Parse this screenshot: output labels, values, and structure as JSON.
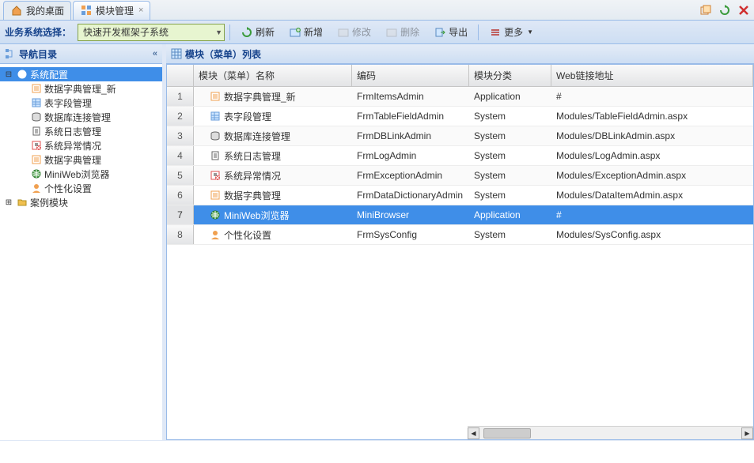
{
  "tabs": [
    {
      "label": "我的桌面",
      "icon": "home"
    },
    {
      "label": "模块管理",
      "icon": "module",
      "closable": true
    }
  ],
  "toolbar": {
    "label": "业务系统选择：",
    "combo_value": "快速开发框架子系统",
    "refresh": "刷新",
    "add": "新增",
    "edit": "修改",
    "delete": "删除",
    "export": "导出",
    "more": "更多"
  },
  "side": {
    "title": "导航目录",
    "tree": [
      {
        "label": "系统配置",
        "icon": "gear",
        "expanded": true,
        "selected": true,
        "children": [
          {
            "label": "数据字典管理_新",
            "icon": "list"
          },
          {
            "label": "表字段管理",
            "icon": "grid"
          },
          {
            "label": "数据库连接管理",
            "icon": "db"
          },
          {
            "label": "系统日志管理",
            "icon": "log"
          },
          {
            "label": "系统异常情况",
            "icon": "alert"
          },
          {
            "label": "数据字典管理",
            "icon": "list"
          },
          {
            "label": "MiniWeb浏览器",
            "icon": "globe"
          },
          {
            "label": "个性化设置",
            "icon": "user"
          }
        ]
      },
      {
        "label": "案例模块",
        "icon": "folder",
        "expanded": false
      }
    ]
  },
  "grid": {
    "title": "模块（菜单）列表",
    "columns": {
      "name": "模块（菜单）名称",
      "code": "编码",
      "cat": "模块分类",
      "url": "Web链接地址"
    },
    "rows": [
      {
        "n": "1",
        "name": "数据字典管理_新",
        "code": "FrmItemsAdmin",
        "cat": "Application",
        "url": "#",
        "icon": "list"
      },
      {
        "n": "2",
        "name": "表字段管理",
        "code": "FrmTableFieldAdmin",
        "cat": "System",
        "url": "Modules/TableFieldAdmin.aspx",
        "icon": "grid"
      },
      {
        "n": "3",
        "name": "数据库连接管理",
        "code": "FrmDBLinkAdmin",
        "cat": "System",
        "url": "Modules/DBLinkAdmin.aspx",
        "icon": "db"
      },
      {
        "n": "4",
        "name": "系统日志管理",
        "code": "FrmLogAdmin",
        "cat": "System",
        "url": "Modules/LogAdmin.aspx",
        "icon": "log"
      },
      {
        "n": "5",
        "name": "系统异常情况",
        "code": "FrmExceptionAdmin",
        "cat": "System",
        "url": "Modules/ExceptionAdmin.aspx",
        "icon": "alert"
      },
      {
        "n": "6",
        "name": "数据字典管理",
        "code": "FrmDataDictionaryAdmin",
        "cat": "System",
        "url": "Modules/DataItemAdmin.aspx",
        "icon": "list"
      },
      {
        "n": "7",
        "name": "MiniWeb浏览器",
        "code": "MiniBrowser",
        "cat": "Application",
        "url": "#",
        "icon": "globe",
        "selected": true
      },
      {
        "n": "8",
        "name": "个性化设置",
        "code": "FrmSysConfig",
        "cat": "System",
        "url": "Modules/SysConfig.aspx",
        "icon": "user"
      }
    ]
  },
  "icons": {
    "home": "#f0a050",
    "module": "#f0a050",
    "gear": "#6a9edb",
    "list": "#f0a050",
    "grid": "#6a9edb",
    "db": "#888",
    "log": "#ddd",
    "alert": "#e05050",
    "globe": "#4aa04a",
    "user": "#f0a050",
    "folder": "#f0c050"
  }
}
